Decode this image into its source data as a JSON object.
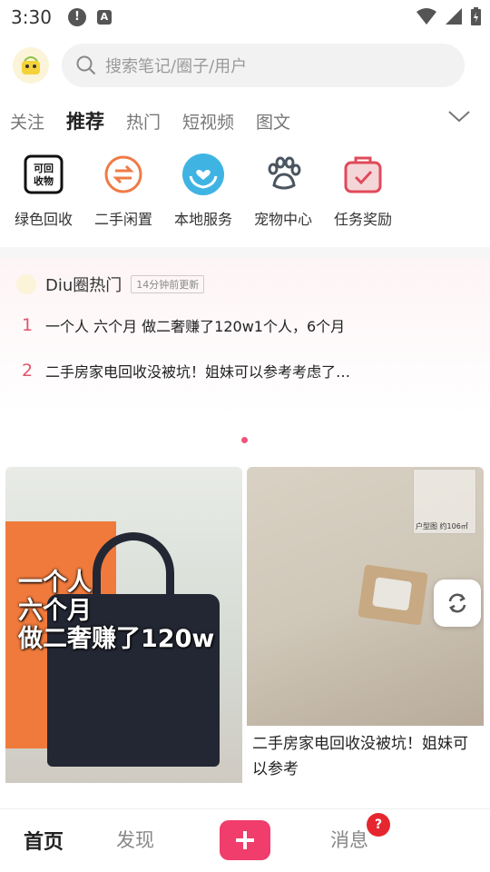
{
  "status_bar": {
    "time": "3:30"
  },
  "search": {
    "placeholder": "搜索笔记/圈子/用户"
  },
  "tabs": [
    {
      "label": "关注"
    },
    {
      "label": "推荐"
    },
    {
      "label": "热门"
    },
    {
      "label": "短视频"
    },
    {
      "label": "图文"
    }
  ],
  "entries": [
    {
      "label": "绿色回收",
      "icon": "recycle-icon",
      "icon_text": "可回收物"
    },
    {
      "label": "二手闲置",
      "icon": "exchange-icon"
    },
    {
      "label": "本地服务",
      "icon": "heart-hands-icon"
    },
    {
      "label": "宠物中心",
      "icon": "paw-icon"
    },
    {
      "label": "任务奖励",
      "icon": "task-bag-icon"
    }
  ],
  "hot": {
    "title": "Diu圈热门",
    "updated": "14分钟前更新",
    "items": [
      {
        "rank": "1",
        "text": "一个人 六个月 做二奢赚了120w1个人，6个月"
      },
      {
        "rank": "2",
        "text": "二手房家电回收没被坑！姐妹可以参考考虑了…"
      }
    ]
  },
  "feed": {
    "left": {
      "overlay_lines": [
        "一个人",
        "六个月",
        "做二奢赚了120w"
      ]
    },
    "right": {
      "title": "二手房家电回收没被坑！姐妹可以参考",
      "floorplan_caption": "户型图 约106㎡"
    }
  },
  "nav": {
    "home": "首页",
    "discover": "发现",
    "messages": "消息",
    "message_badge": "?"
  },
  "colors": {
    "accent": "#f03d6c",
    "rank": "#e0556a"
  }
}
